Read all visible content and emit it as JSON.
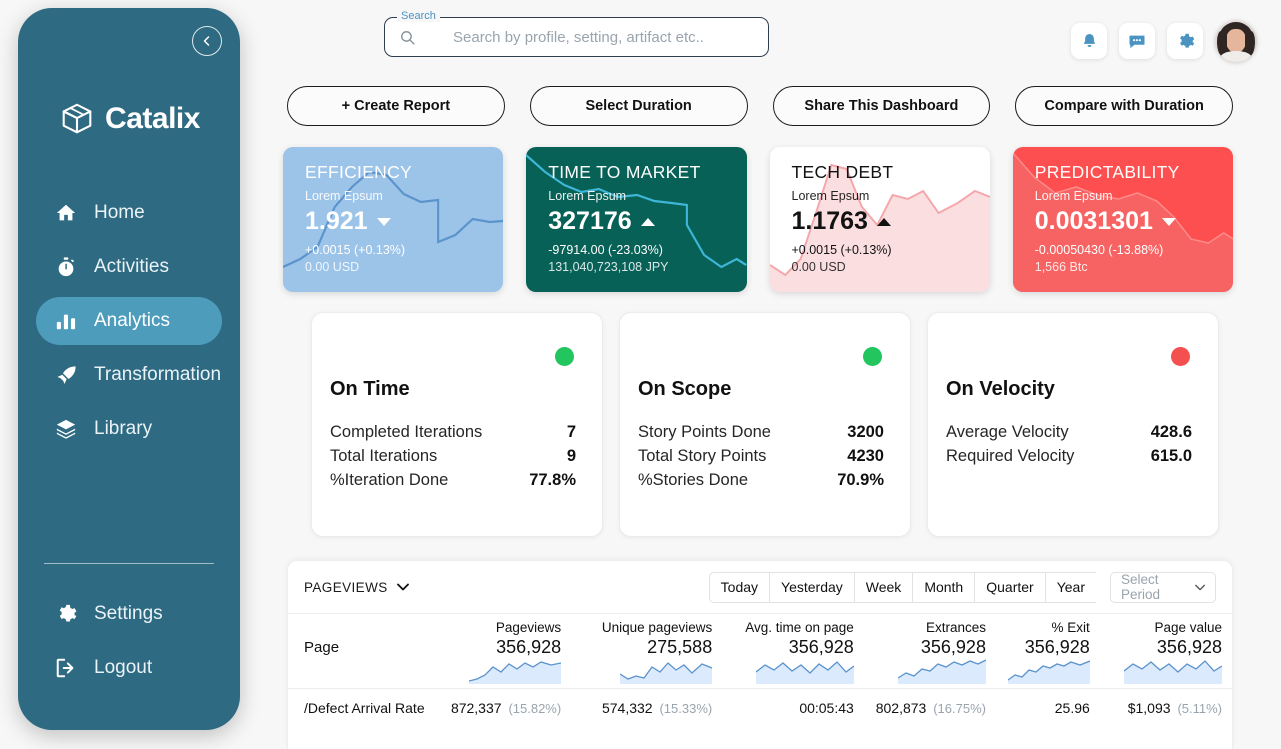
{
  "sidebar": {
    "brand": "Catalix",
    "collapse_icon": "chevron-left-icon",
    "items": [
      {
        "label": "Home",
        "icon": "home-icon",
        "active": false
      },
      {
        "label": "Activities",
        "icon": "stopwatch-icon",
        "active": false
      },
      {
        "label": "Analytics",
        "icon": "bar-chart-icon",
        "active": true
      },
      {
        "label": "Transformation",
        "icon": "rocket-icon",
        "active": false
      },
      {
        "label": "Library",
        "icon": "layers-icon",
        "active": false
      }
    ],
    "bottom_items": [
      {
        "label": "Settings",
        "icon": "gear-icon"
      },
      {
        "label": "Logout",
        "icon": "logout-icon"
      }
    ]
  },
  "topbar": {
    "search": {
      "legend": "Search",
      "placeholder": "Search by profile, setting, artifact etc..",
      "value": ""
    },
    "icons": [
      "bell-icon",
      "chat-icon",
      "gear-icon"
    ],
    "avatar": "user-avatar"
  },
  "actions": [
    {
      "label": "+  Create Report"
    },
    {
      "label": "Select Duration"
    },
    {
      "label": "Share This Dashboard"
    },
    {
      "label": "Compare with Duration"
    }
  ],
  "kpis": [
    {
      "title": "EFFICIENCY",
      "subtitle": "Lorem Epsum",
      "value": "1.921",
      "direction": "down",
      "change": "+0.0015  (+0.13%)",
      "unit": "0.00 USD",
      "theme": "blue",
      "color": "#9CC3E8",
      "line_color": "#5b93cc"
    },
    {
      "title": "TIME TO MARKET",
      "subtitle": "Lorem Epsum",
      "value": "327176",
      "direction": "up",
      "change": "-97914.00 (-23.03%)",
      "unit": "131,040,723,108 JPY",
      "theme": "teal",
      "color": "#076157",
      "line_color": "#3fb6d8"
    },
    {
      "title": "TECH DEBT",
      "subtitle": "Lorem Epsum",
      "value": "1.1763",
      "direction": "up",
      "change": "+0.0015 (+0.13%)",
      "unit": "0.00 USD",
      "theme": "white",
      "color": "#FFFFFF",
      "line_color": "#f4a7ab"
    },
    {
      "title": "PREDICTABILITY",
      "subtitle": "Lorem Epsum",
      "value": "0.0031301",
      "direction": "down",
      "change": "-0.00050430 (-13.88%)",
      "unit": "1,566 Btc",
      "theme": "red",
      "color": "#FD4F4F",
      "line_color": "#f07070"
    }
  ],
  "stats": [
    {
      "title": "On Time",
      "status_color": "#22c55e",
      "rows": [
        {
          "label": "Completed Iterations",
          "value": "7"
        },
        {
          "label": "Total Iterations",
          "value": "9"
        },
        {
          "label": "%Iteration Done",
          "value": "77.8%"
        }
      ]
    },
    {
      "title": "On Scope",
      "status_color": "#22c55e",
      "rows": [
        {
          "label": "Story Points Done",
          "value": "3200"
        },
        {
          "label": "Total Story Points",
          "value": "4230"
        },
        {
          "label": "%Stories Done",
          "value": "70.9%"
        }
      ]
    },
    {
      "title": "On Velocity",
      "status_color": "#f4504f",
      "rows": [
        {
          "label": "Average Velocity",
          "value": "428.6"
        },
        {
          "label": "Required Velocity",
          "value": "615.0"
        }
      ]
    }
  ],
  "table": {
    "metric_select": "PAGEVIEWS",
    "segments": [
      "Today",
      "Yesterday",
      "Week",
      "Month",
      "Quarter",
      "Year"
    ],
    "period_select": "Select Period",
    "columns": [
      "",
      "Pageviews",
      "Unique pageviews",
      "Avg. time on page",
      "Extrances",
      "% Exit",
      "Page value"
    ],
    "summary": [
      "Page",
      "356,928",
      "275,588",
      "356,928",
      "356,928",
      "356,928",
      "356,928"
    ],
    "rows": [
      {
        "page": "/Defect Arrival Rate",
        "cells": [
          {
            "value": "872,337",
            "pct": "(15.82%)"
          },
          {
            "value": "574,332",
            "pct": "(15.33%)"
          },
          {
            "value": "00:05:43",
            "pct": ""
          },
          {
            "value": "802,873",
            "pct": "(16.75%)"
          },
          {
            "value": "25.96",
            "pct": ""
          },
          {
            "value": "$1,093",
            "pct": "(5.11%)"
          }
        ]
      }
    ]
  },
  "chart_data": {
    "type": "line",
    "title": "KPI sparklines",
    "series": [
      {
        "name": "EFFICIENCY",
        "values": [
          10,
          22,
          18,
          30,
          55,
          92,
          88,
          70,
          60,
          62,
          30,
          34,
          48,
          45
        ]
      },
      {
        "name": "TIME TO MARKET",
        "values": [
          95,
          88,
          74,
          68,
          70,
          64,
          66,
          60,
          58,
          40,
          20,
          18,
          28,
          22
        ]
      },
      {
        "name": "TECH DEBT",
        "values": [
          12,
          8,
          30,
          58,
          95,
          72,
          48,
          64,
          86,
          80,
          84,
          62,
          70,
          76
        ]
      },
      {
        "name": "PREDICTABILITY",
        "values": [
          92,
          78,
          66,
          70,
          64,
          60,
          66,
          58,
          44,
          30,
          28,
          34,
          26,
          30
        ]
      }
    ],
    "grid": false,
    "legend": "none"
  },
  "table_sparklines": {
    "type": "area",
    "series": [
      {
        "name": "Pageviews",
        "values": [
          10,
          14,
          22,
          40,
          62,
          55,
          72,
          60,
          78,
          70,
          82,
          76
        ]
      },
      {
        "name": "Unique pageviews",
        "values": [
          30,
          18,
          26,
          22,
          58,
          40,
          72,
          50,
          66,
          44,
          70,
          58
        ]
      },
      {
        "name": "Avg. time on page",
        "values": [
          40,
          66,
          50,
          74,
          48,
          70,
          44,
          72,
          52,
          76,
          46,
          68
        ]
      },
      {
        "name": "Extrances",
        "values": [
          22,
          38,
          28,
          52,
          44,
          70,
          62,
          78,
          66,
          80,
          72,
          84
        ]
      },
      {
        "name": "% Exit",
        "values": [
          18,
          30,
          26,
          48,
          40,
          62,
          56,
          70,
          60,
          74,
          64,
          78
        ]
      },
      {
        "name": "Page value",
        "values": [
          44,
          68,
          52,
          76,
          50,
          72,
          46,
          70,
          54,
          78,
          48,
          66
        ]
      }
    ]
  }
}
